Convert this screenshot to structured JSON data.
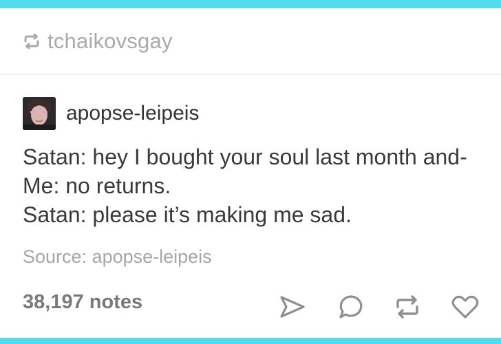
{
  "reblog": {
    "username": "tchaikovsgay"
  },
  "post": {
    "author": "apopse-leipeis",
    "lines": [
      "Satan: hey I bought your soul last month and-",
      "Me: no returns.",
      "Satan: please it’s making me sad."
    ],
    "source": "Source: apopse-leipeis",
    "notes": "38,197 notes"
  },
  "actions": {
    "icons": [
      "share-icon",
      "reply-icon",
      "reblog-icon",
      "like-icon"
    ]
  },
  "colors": {
    "accent_bar": "#52dcf0",
    "icon_gray": "#8f8f8f",
    "text_dark": "#3a3a3a",
    "text_muted": "#a9a9a9"
  }
}
